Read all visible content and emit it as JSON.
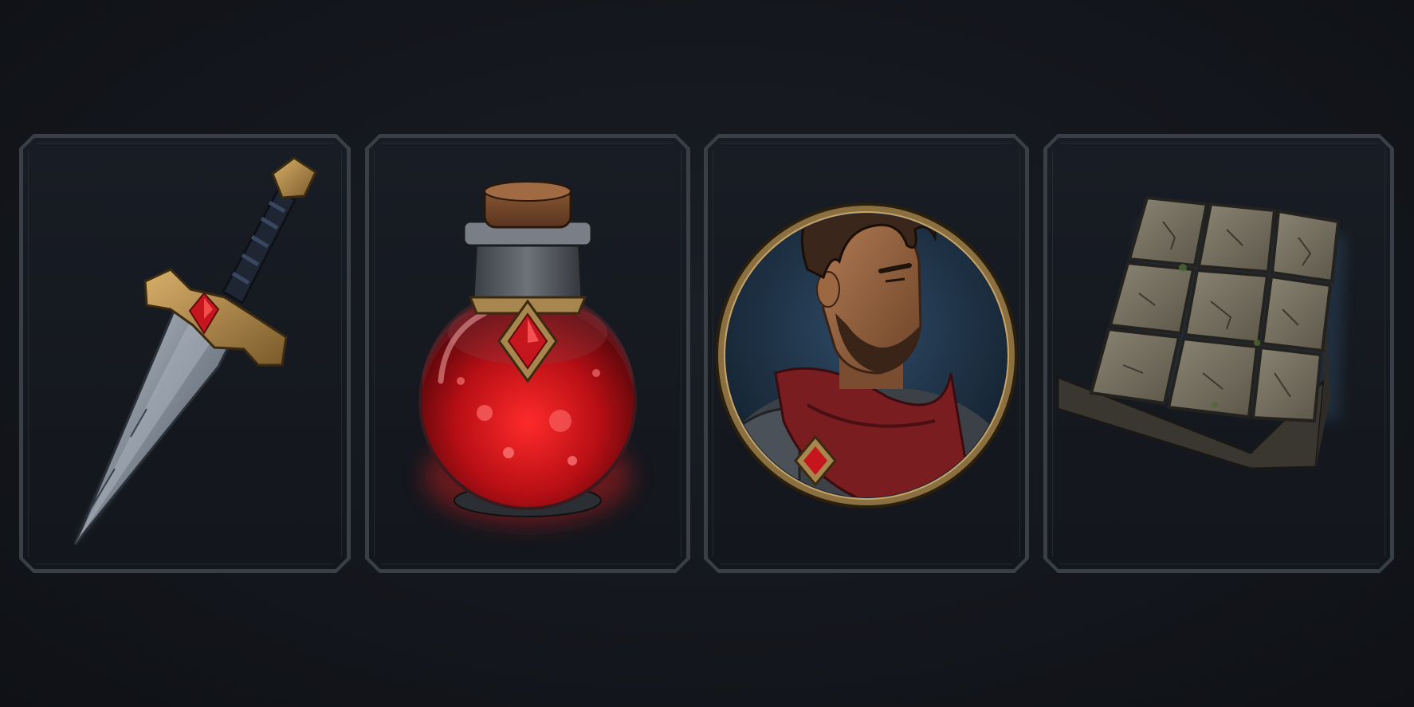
{
  "inventory": {
    "slots": [
      {
        "item": "dagger",
        "icon": "dagger-icon"
      },
      {
        "item": "health-potion",
        "icon": "potion-icon"
      },
      {
        "item": "hero-portrait",
        "icon": "portrait-icon"
      },
      {
        "item": "stone-floor-tile",
        "icon": "stone-tile-icon"
      }
    ]
  },
  "colors": {
    "background": "#12151b",
    "frame": "#3a3f47",
    "gold": "#a8874e",
    "ruby": "#c4161c",
    "potion": "#d0101a",
    "steel": "#8f98a3",
    "stone": "#6f6a5e"
  }
}
